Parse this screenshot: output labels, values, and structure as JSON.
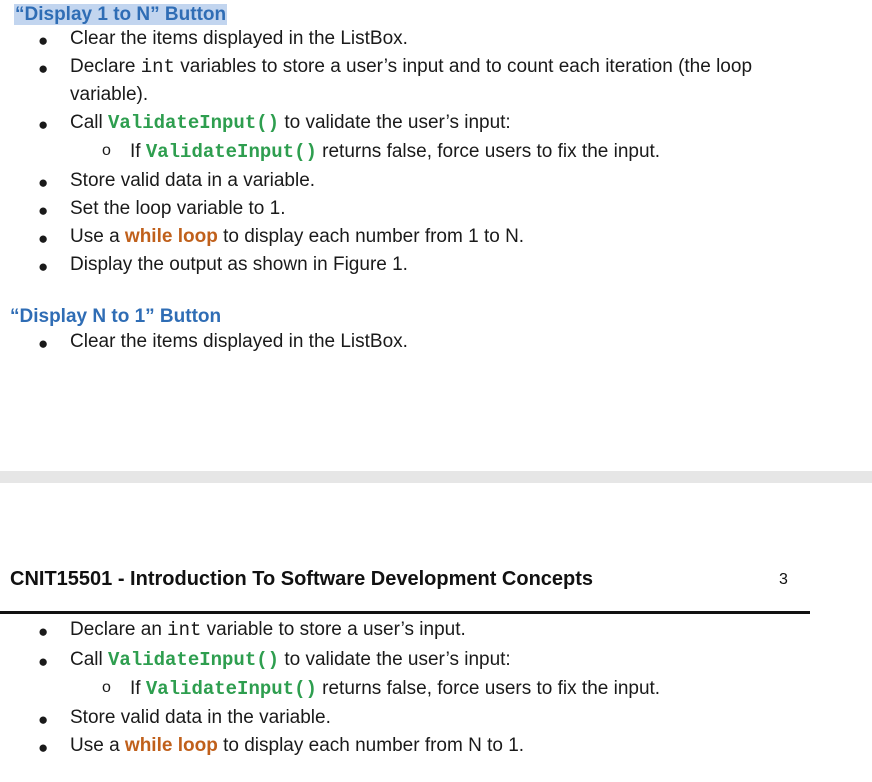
{
  "section1": {
    "heading": "“Display 1 to N” Button",
    "b1": "Clear the items displayed in the ListBox.",
    "b2_pre": "Declare ",
    "b2_code": "int",
    "b2_post": " variables to store a user’s input and to count each iteration (the loop",
    "b2_cont": "variable).",
    "b3_pre": "Call ",
    "b3_fn": "ValidateInput()",
    "b3_post": " to validate the user’s input:",
    "s1_marker": "o",
    "s1_pre": "If ",
    "s1_fn": "ValidateInput()",
    "s1_post": " returns false, force users to fix the input.",
    "b4": "Store valid data in a variable.",
    "b5": "Set the loop variable to 1.",
    "b6_pre": "Use a ",
    "b6_kw": "while loop",
    "b6_post": " to display each number from 1 to N.",
    "b7": "Display the output as shown in Figure 1."
  },
  "section2": {
    "heading": "“Display N to 1” Button",
    "b1": "Clear the items displayed in the ListBox."
  },
  "page_header": {
    "title": "CNIT15501 - Introduction To Software Development Concepts",
    "page_number": "3"
  },
  "section2_cont": {
    "b1_pre": "Declare an ",
    "b1_code": "int",
    "b1_post": " variable to store a user’s input.",
    "b2_pre": "Call ",
    "b2_fn": "ValidateInput()",
    "b2_post": " to validate the user’s input:",
    "s1_marker": "o",
    "s1_pre": "If ",
    "s1_fn": "ValidateInput()",
    "s1_post": " returns false, force users to fix the input.",
    "b3": "Store valid data in the variable.",
    "b4_pre": "Use a ",
    "b4_kw": "while loop",
    "b4_post": " to display each number from N to 1."
  },
  "bullet_glyph": "●",
  "colors": {
    "heading": "#2f6db5",
    "code_fn": "#2e9e4f",
    "keyword": "#c0601b",
    "highlight": "#c2d5ef"
  }
}
